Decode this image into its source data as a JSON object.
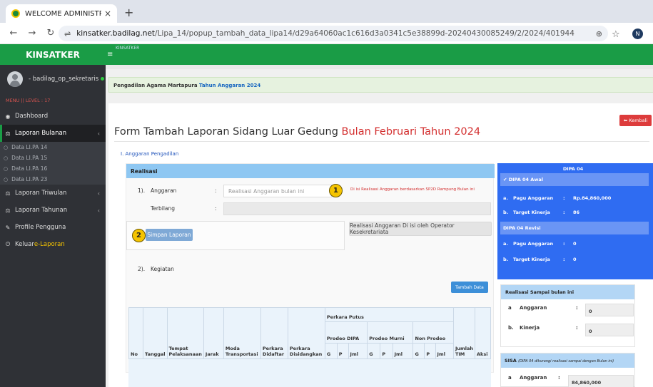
{
  "browser": {
    "tab_title": "WELCOME ADMINISTRATOR",
    "url_host": "kinsatker.badilag.net",
    "url_path": "/Lipa_14/popup_tambah_data_lipa14/d29a64060ac1c616d3a0341c5e38899d-20240430085249/2/2024/401944",
    "profile_initial": "N"
  },
  "sidebar": {
    "brand": "KINSATKER",
    "username": "- badilag_op_sekretaris",
    "menu_level": "MENU || LEVEL : 17",
    "items": [
      {
        "label": "Dashboard"
      },
      {
        "label": "Laporan Bulanan"
      },
      {
        "label": "Laporan Triwulan"
      },
      {
        "label": "Laporan Tahunan"
      },
      {
        "label": "Profile Pengguna"
      },
      {
        "label": "Keluar ",
        "highlight": "e-Laporan"
      }
    ],
    "sub_items": [
      "Data LI.PA 14",
      "Data LI.PA 15",
      "Data LI.PA 16",
      "Data LI.PA 23"
    ]
  },
  "topnav": {
    "small_label": "KINSATKER"
  },
  "alert": {
    "text": "Pengadilan Agama Martapura ",
    "year_text": "Tahun Anggaran 2024"
  },
  "page": {
    "title_main": "Form Tambah Laporan Sidang Luar Gedung ",
    "title_period": "Bulan Februari Tahun 2024",
    "back_label": "Kembali",
    "section_label": "I. Anggaran Pengadilan"
  },
  "realisasi": {
    "header": "Realisasi",
    "row1_no": "1).",
    "row1_label": "Anggaran",
    "row2_label": "Terbilang",
    "colon": ":",
    "anggaran_placeholder": "Realisasi Anggaran bulan ini",
    "anggaran_hint": "Di isi Realisasi Anggaran berdasarkan SP2D Rampung Bulan ini",
    "badge1": "1",
    "badge2": "2",
    "save_label": "Simpan Laporan",
    "operator_label": "Realisasi Anggaran Di isi oleh Operator Kesekretariata",
    "kegiatan_no": "2).",
    "kegiatan_label": "Kegiatan",
    "add_label": "Tambah Data"
  },
  "table": {
    "perkara_putus": "Perkara Putus",
    "prodeo_dipa": "Prodeo DIPA",
    "prodeo_murni": "Prodeo Murni",
    "non_prodeo": "Non Prodeo",
    "cols": {
      "no": "No",
      "tanggal": "Tanggal",
      "tempat": "Tempat Pelaksanaan",
      "jarak": "Jarak",
      "moda": "Moda Transportasi",
      "didaftar": "Perkara Didaftar",
      "disidangkan": "Perkara Disidangkan",
      "g": "G",
      "p": "P",
      "jml": "Jml",
      "jumlah_tim": "Jumlah TIM",
      "aksi": "Aksi"
    }
  },
  "dipa": {
    "title": "DIPA 04",
    "awal_label": "DIPA 04 Awal",
    "revisi_label": "DIPA 04 Revisi",
    "key_a": "a.",
    "key_b": "b.",
    "pagu_label": "Pagu Anggaran",
    "target_label": "Target Kinerja",
    "sep": ":",
    "awal_pagu": "Rp.84,860,000",
    "awal_target": "86",
    "revisi_pagu": "0",
    "revisi_target": "0"
  },
  "realisasi_sampai": {
    "title": "Realisasi Sampai bulan ini",
    "key_a": "a",
    "key_b": "b.",
    "anggaran_label": "Anggaran",
    "kinerja_label": "Kinerja",
    "colon": ":",
    "anggaran_value": "0",
    "kinerja_value": "0"
  },
  "sisa": {
    "title": "SISA",
    "note": "(DIPA 04 dikurangi realisasi sampai dengan Bulan ini)",
    "key_a": "a",
    "anggaran_label": "Anggaran",
    "colon": ":",
    "anggaran_value": "84,860,000"
  }
}
